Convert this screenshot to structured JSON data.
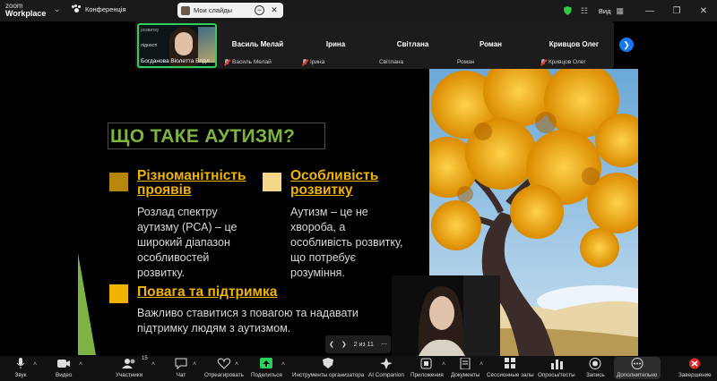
{
  "titlebar": {
    "app_line1": "zoom",
    "app_line2": "Workplace",
    "meeting_label": "Конференція",
    "share_label": "Мои слайды",
    "view_label": "Вид",
    "brand_green": "#2ecc40"
  },
  "strip": {
    "active": {
      "name": "Богданова Віолетта Влдл...",
      "side_text_1": "розвитку",
      "side_text_2": "лідності"
    },
    "participants": [
      {
        "display": "Василь Мелай",
        "label": "Василь Мелай",
        "muted": true
      },
      {
        "display": "Ірина",
        "label": "Ірина",
        "muted": true
      },
      {
        "display": "Світлана",
        "label": "Світлана",
        "muted": false
      },
      {
        "display": "Роман",
        "label": "Роман",
        "muted": false
      },
      {
        "display": "Кривцов Олег",
        "label": "Кривцов Олег",
        "muted": true
      }
    ]
  },
  "slide": {
    "title": "ЩО ТАКЕ АУТИЗМ?",
    "blocks": [
      {
        "heading": "Різноманітність проявів",
        "text": "Розлад спектру аутизму (РСА) – це широкий діапазон особливостей розвитку.",
        "color": "#b8860b"
      },
      {
        "heading": "Особливість розвитку",
        "text": "Аутизм – це не хвороба, а особливість розвитку, що потребує розуміння.",
        "color": "#f2d888"
      },
      {
        "heading": "Повага та підтримка",
        "text": "Важливо ставитися з повагою та надавати підтримку людям з аутизмом.",
        "color": "#f0b400"
      }
    ],
    "heading_color": "#f0b400",
    "title_color": "#7cb342",
    "pager": "2 из 11"
  },
  "toolbar": {
    "items": [
      {
        "label": "Звук",
        "icon": "microphone-icon"
      },
      {
        "label": "Видео",
        "icon": "video-camera-icon"
      },
      {
        "label": "Участники",
        "icon": "participants-icon",
        "count": "15"
      },
      {
        "label": "Чат",
        "icon": "chat-icon"
      },
      {
        "label": "Отреагировать",
        "icon": "heart-icon"
      },
      {
        "label": "Поделиться",
        "icon": "share-screen-icon"
      },
      {
        "label": "Инструменты организатора",
        "icon": "host-tools-shield-icon"
      },
      {
        "label": "AI Companion",
        "icon": "ai-sparkle-icon"
      },
      {
        "label": "Приложения",
        "icon": "apps-icon"
      },
      {
        "label": "Документы",
        "icon": "documents-icon"
      },
      {
        "label": "Сессионные залы",
        "icon": "breakout-rooms-icon"
      },
      {
        "label": "Опросы/тесты",
        "icon": "polls-icon"
      },
      {
        "label": "Запись",
        "icon": "record-icon"
      },
      {
        "label": "Дополнительно",
        "icon": "more-icon"
      },
      {
        "label": "Завершение",
        "icon": "end-meeting-icon"
      }
    ],
    "share_color": "#2bd15a",
    "end_color": "#e02828"
  }
}
